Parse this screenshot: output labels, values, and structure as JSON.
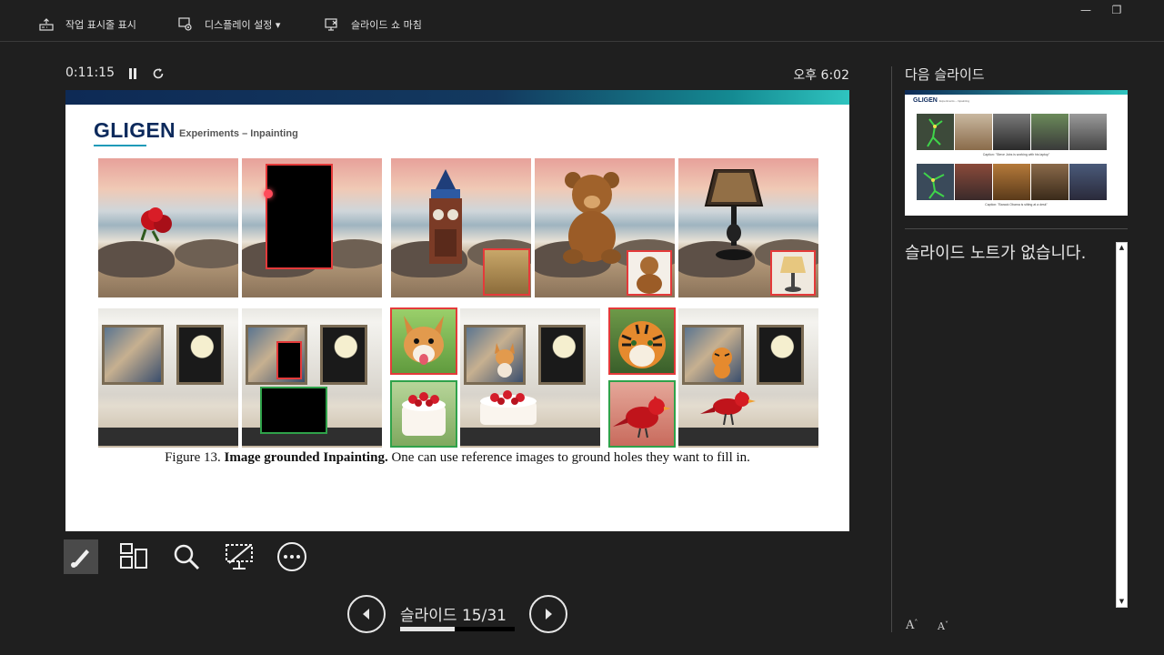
{
  "toolbar": {
    "show_taskbar_label": "작업 표시줄 표시",
    "display_settings_label": "디스플레이 설정 ▾",
    "end_show_label": "슬라이드 쇼 마침",
    "minimize_glyph": "—",
    "restore_glyph": "❐"
  },
  "presenter": {
    "elapsed_time": "0:11:15",
    "clock": "오후 6:02"
  },
  "slide": {
    "brand": "GLIGEN",
    "subtitle": "Experiments – Inpainting",
    "caption_figure": "Figure 13. ",
    "caption_bold": "Image grounded Inpainting.",
    "caption_rest": " One can use reference images to ground holes they want to fill in."
  },
  "slide_tools": [
    "pen-tool",
    "see-all-slides",
    "zoom",
    "black-screen",
    "more-options"
  ],
  "navigation": {
    "label": "슬라이드 15/31",
    "current": 15,
    "total": 31,
    "progress_fraction": 0.48
  },
  "next_slide": {
    "heading": "다음 슬라이드",
    "brand": "GLIGEN",
    "subtitle": "Experiments – Inpainting",
    "caption_top": "Caption: \"Steve Jobs is working with his laptop\"",
    "caption_bottom": "Caption: \"Barack Obama is sitting at a desk\""
  },
  "notes": {
    "text": "슬라이드 노트가 없습니다.",
    "scroll_up": "▲",
    "scroll_down": "▼",
    "increase_font": "A",
    "decrease_font": "A"
  },
  "colors": {
    "background": "#1f1f1f",
    "text": "#e6e6e6",
    "slide_band_start": "#0e2a55",
    "slide_band_end": "#2fc4bf",
    "brand": "#0d2a5c",
    "box_red": "#e43a3a",
    "box_green": "#2fa24a"
  }
}
